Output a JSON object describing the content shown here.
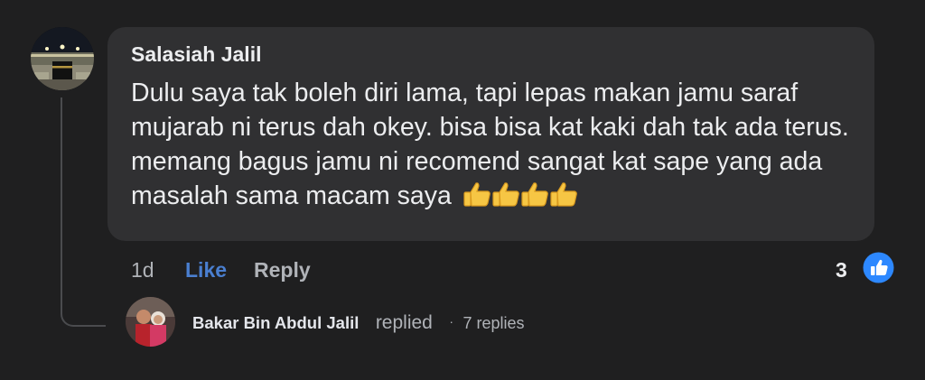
{
  "comment": {
    "author": "Salasiah Jalil",
    "text": "Dulu saya tak boleh diri lama, tapi lepas makan jamu saraf mujarab ni terus dah okey. bisa bisa kat kaki dah tak ada terus. memang bagus jamu ni recomend sangat kat sape yang ada masalah sama macam saya",
    "emoji": [
      "thumbs-up",
      "thumbs-up",
      "thumbs-up",
      "thumbs-up"
    ],
    "timestamp": "1d",
    "like_label": "Like",
    "reply_label": "Reply",
    "reaction_count": "3",
    "reaction_icon": "like-icon",
    "colors": {
      "background": "#1f1f20",
      "bubble": "#303032",
      "like_text": "#4a7fd0",
      "reaction_badge": "#2d88ff",
      "muted_text": "#b0b3b8"
    }
  },
  "reply_preview": {
    "author": "Bakar Bin Abdul Jalil",
    "action": "replied",
    "separator": "·",
    "count_label": "7 replies"
  }
}
